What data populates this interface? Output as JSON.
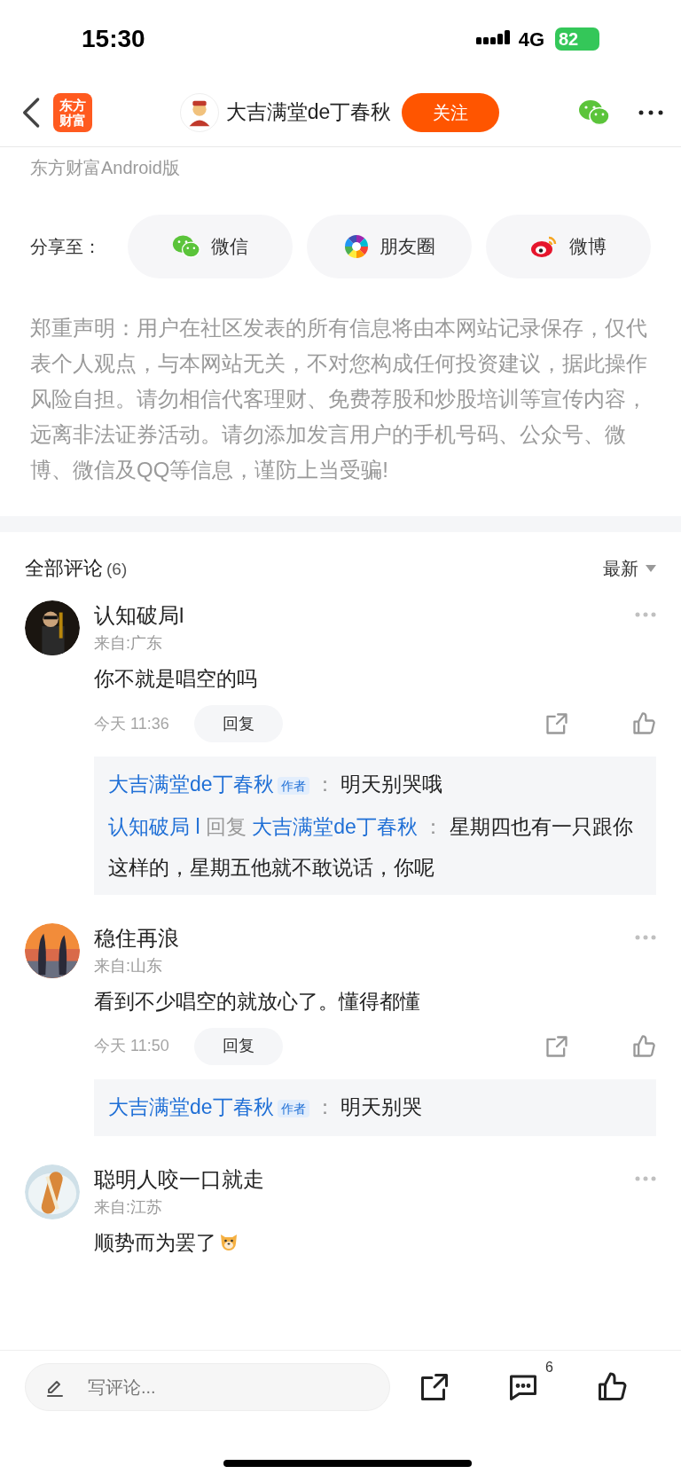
{
  "status_bar": {
    "time": "15:30",
    "network": "4G",
    "battery": "82"
  },
  "nav": {
    "logo": "东方财富",
    "author": "大吉满堂de丁春秋",
    "follow": "关注"
  },
  "source": "东方财富Android版",
  "share": {
    "label": "分享至：",
    "targets": [
      {
        "kind": "wechat",
        "label": "微信"
      },
      {
        "kind": "moments",
        "label": "朋友圈"
      },
      {
        "kind": "weibo",
        "label": "微博"
      }
    ]
  },
  "disclaimer": "郑重声明：用户在社区发表的所有信息将由本网站记录保存，仅代表个人观点，与本网站无关，不对您构成任何投资建议，据此操作风险自担。请勿相信代客理财、免费荐股和炒股培训等宣传内容，远离非法证券活动。请勿添加发言用户的手机号码、公众号、微博、微信及QQ等信息，谨防上当受骗!",
  "comments_header": {
    "title": "全部评论",
    "count": "(6)",
    "sort": "最新"
  },
  "comments": [
    {
      "user": "认知破局l",
      "location": "来自:广东",
      "text": "你不就是唱空的吗",
      "time": "今天 11:36",
      "reply_button": "回复",
      "replies": [
        {
          "kind": "author",
          "user": "大吉满堂de丁春秋",
          "badge": "作者",
          "sep": "：",
          "text": "明天别哭哦"
        },
        {
          "kind": "reply_to",
          "user": "认知破局 l",
          "verb": "回复",
          "target": "大吉满堂de丁春秋",
          "sep": "：",
          "text": "星期四也有一只跟你这样的，星期五他就不敢说话，你呢"
        }
      ]
    },
    {
      "user": "稳住再浪",
      "location": "来自:山东",
      "text": "看到不少唱空的就放心了。懂得都懂",
      "time": "今天 11:50",
      "reply_button": "回复",
      "replies": [
        {
          "kind": "author",
          "user": "大吉满堂de丁春秋",
          "badge": "作者",
          "sep": "：",
          "text": "明天别哭"
        }
      ]
    },
    {
      "user": "聪明人咬一口就走",
      "location": "来自:江苏",
      "text": "顺势而为罢了",
      "emoji": true
    }
  ],
  "bottom_bar": {
    "placeholder": "写评论...",
    "comment_count": "6"
  }
}
